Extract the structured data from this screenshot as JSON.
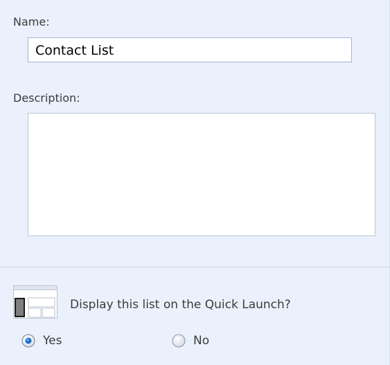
{
  "form": {
    "name_label": "Name:",
    "name_value": "Contact List",
    "description_label": "Description:",
    "description_value": ""
  },
  "quick_launch": {
    "icon": "quick-launch-layout-icon",
    "question": "Display this list on the Quick Launch?",
    "options": [
      {
        "label": "Yes",
        "selected": true
      },
      {
        "label": "No",
        "selected": false
      }
    ]
  },
  "colors": {
    "panel_background": "#eaf1fc",
    "input_border": "#9fb5d2",
    "radio_selected": "#1f6fd1"
  }
}
